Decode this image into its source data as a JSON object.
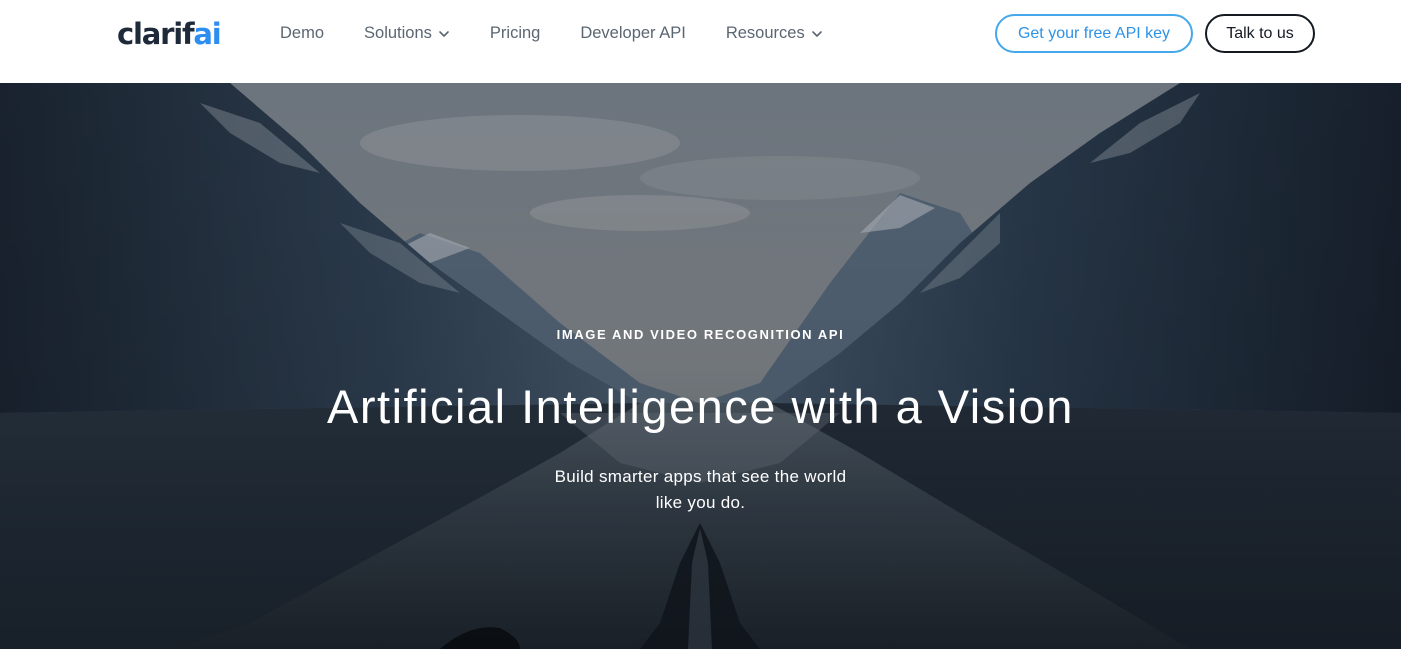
{
  "brand": {
    "logo_main": "clarif",
    "logo_accent": "ai",
    "accent_color": "#2d8ef0"
  },
  "nav": {
    "items": [
      {
        "label": "Demo",
        "has_dropdown": false
      },
      {
        "label": "Solutions",
        "has_dropdown": true,
        "icon": "chevron-down-icon"
      },
      {
        "label": "Pricing",
        "has_dropdown": false
      },
      {
        "label": "Developer API",
        "has_dropdown": false
      },
      {
        "label": "Resources",
        "has_dropdown": true,
        "icon": "chevron-down-icon"
      }
    ]
  },
  "header_buttons": {
    "api_key_label": "Get your free API key",
    "talk_label": "Talk to us"
  },
  "hero": {
    "eyebrow": "IMAGE AND VIDEO RECOGNITION API",
    "headline": "Artificial Intelligence with a Vision",
    "subhead": "Build smarter apps that see the world like you do."
  }
}
